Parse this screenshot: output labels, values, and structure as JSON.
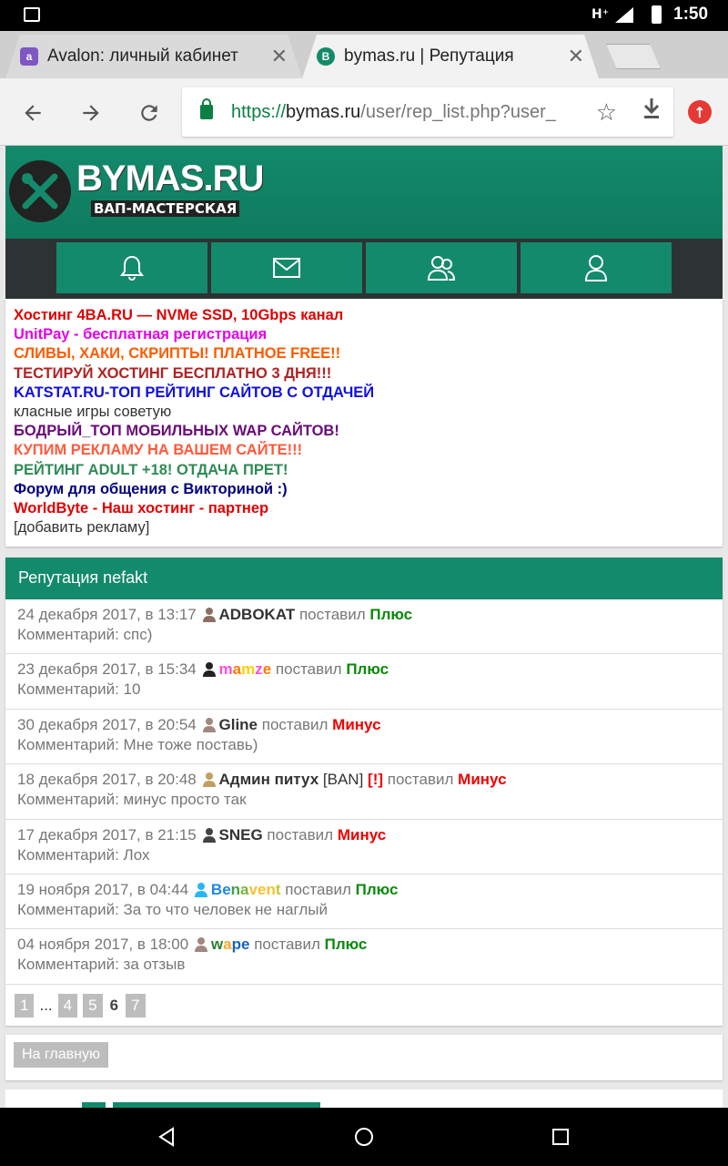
{
  "status_bar": {
    "network": "H⁺",
    "time": "1:50"
  },
  "tabs": [
    {
      "title": "Avalon: личный кабинет",
      "favicon_letter": "a",
      "favicon_color": "#7e57c2"
    },
    {
      "title": "bymas.ru | Репутация",
      "favicon_letter": "B",
      "favicon_color": "#138a6b"
    }
  ],
  "address": {
    "scheme": "https://",
    "host": "bymas.ru",
    "path": "/user/rep_list.php?user_"
  },
  "site": {
    "logo": "BYMAS.RU",
    "tagline": "ВАП-МАСТЕРСКАЯ"
  },
  "ads": [
    {
      "text": "Хостинг 4BA.RU — NVMe SSD, 10Gbps канал",
      "color": "#e00000",
      "bold": true
    },
    {
      "text": "UnitPay - бесплатная регистрация",
      "color": "#e600e6",
      "bold": true
    },
    {
      "text": "СЛИВЫ, ХАКИ, СКРИПТЫ! ПЛАТНОЕ FREE!!",
      "color": "#ff5a00",
      "bold": true
    },
    {
      "text": "ТЕСТИРУЙ ХОСТИНГ БЕСПЛАТНО 3 ДНЯ!!!",
      "color": "#b22222",
      "bold": true
    },
    {
      "text": "KATSTAT.RU-ТОП РЕЙТИНГ САЙТОВ С ОТДАЧЕЙ",
      "color": "#1010e0",
      "bold": true
    },
    {
      "text": "класные игры советую",
      "color": "#333333",
      "bold": false
    },
    {
      "text": "БОДРЫЙ_ТОП МОБИЛЬНЫХ WAP САЙТОВ!",
      "color": "#6a0a7a",
      "bold": true
    },
    {
      "text": "КУПИМ РЕКЛАМУ НА ВАШЕМ САЙТЕ!!!",
      "color": "#ff5a3c",
      "bold": true
    },
    {
      "text": "РЕЙТИНГ ADULT +18! ОТДАЧА ПРЕТ!",
      "color": "#2e8b57",
      "bold": true
    },
    {
      "text": "Форум для общения с Викториной :)",
      "color": "#000080",
      "bold": true
    },
    {
      "text": "WorldByte - Наш хостинг - партнер",
      "color": "#e00000",
      "bold": true
    },
    {
      "text": "[добавить рекламу]",
      "color": "#333333",
      "bold": false
    }
  ],
  "reputation": {
    "title": "Репутация nefakt",
    "action_word": "поставил",
    "comment_prefix": "Комментарий:",
    "entries": [
      {
        "date": "24 декабря 2017, в 13:17",
        "user": "ADBOKAT",
        "extra": "",
        "ban_mark": "",
        "vote": "Плюс",
        "positive": true,
        "comment": "спс)",
        "avatar": "#8d6e63"
      },
      {
        "date": "23 декабря 2017, в 15:34",
        "user": "mamze",
        "extra": "",
        "ban_mark": "",
        "vote": "Плюс",
        "positive": true,
        "comment": "10",
        "avatar": "#212121"
      },
      {
        "date": "30 декабря 2017, в 20:54",
        "user": "Gline",
        "extra": "",
        "ban_mark": "",
        "vote": "Минус",
        "positive": false,
        "comment": "Мне тоже поставь)",
        "avatar": "#a1887f"
      },
      {
        "date": "18 декабря 2017, в 20:48",
        "user": "Админ питух",
        "extra": "[BAN]",
        "ban_mark": "[!]",
        "vote": "Минус",
        "positive": false,
        "comment": "минус просто так",
        "avatar": "#c0a060"
      },
      {
        "date": "17 декабря 2017, в 21:15",
        "user": "SNEG",
        "extra": "",
        "ban_mark": "",
        "vote": "Минус",
        "positive": false,
        "comment": "Лох",
        "avatar": "#424242"
      },
      {
        "date": "19 ноября 2017, в 04:44",
        "user": "Benavent",
        "extra": "",
        "ban_mark": "",
        "vote": "Плюс",
        "positive": true,
        "comment": "За то что человек не наглый",
        "avatar": "#29b6f6"
      },
      {
        "date": "04 ноября 2017, в 18:00",
        "user": "wape",
        "extra": "",
        "ban_mark": "",
        "vote": "Плюс",
        "positive": true,
        "comment": "за отзыв",
        "avatar": "#a1887f"
      }
    ]
  },
  "pagination": {
    "first": "1",
    "ellipsis": "...",
    "prev2": "4",
    "prev1": "5",
    "current": "6",
    "next": "7"
  },
  "home_button": "На главную"
}
